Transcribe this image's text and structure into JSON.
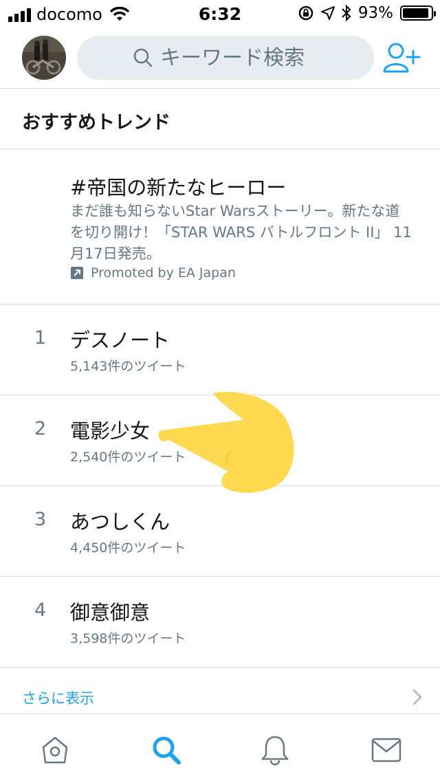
{
  "status_bar": {
    "carrier": "docomo",
    "time": "6:32",
    "battery_percent": "93%",
    "battery_level": 0.93
  },
  "header": {
    "search_placeholder": "キーワード検索"
  },
  "section_title": "おすすめトレンド",
  "promoted": {
    "title": "#帝国の新たなヒーロー",
    "description": "まだ誰も知らないStar Warsストーリー。新たな道を切り開け！「STAR WARS バトルフロント II」 11月17日発売。",
    "promoted_by": "Promoted by EA Japan"
  },
  "trends": [
    {
      "rank": "1",
      "name": "デスノート",
      "count": "5,143件のツイート"
    },
    {
      "rank": "2",
      "name": "電影少女",
      "count": "2,540件のツイート"
    },
    {
      "rank": "3",
      "name": "あつしくん",
      "count": "4,450件のツイート"
    },
    {
      "rank": "4",
      "name": "御意御意",
      "count": "3,598件のツイート"
    }
  ],
  "show_more": "さらに表示",
  "tabs": {
    "home": "home-icon",
    "search": "search-icon",
    "notifications": "bell-icon",
    "messages": "mail-icon",
    "active": "search"
  },
  "colors": {
    "accent": "#1da1f2",
    "secondary_text": "#657786",
    "finger": "#ffd94f"
  }
}
